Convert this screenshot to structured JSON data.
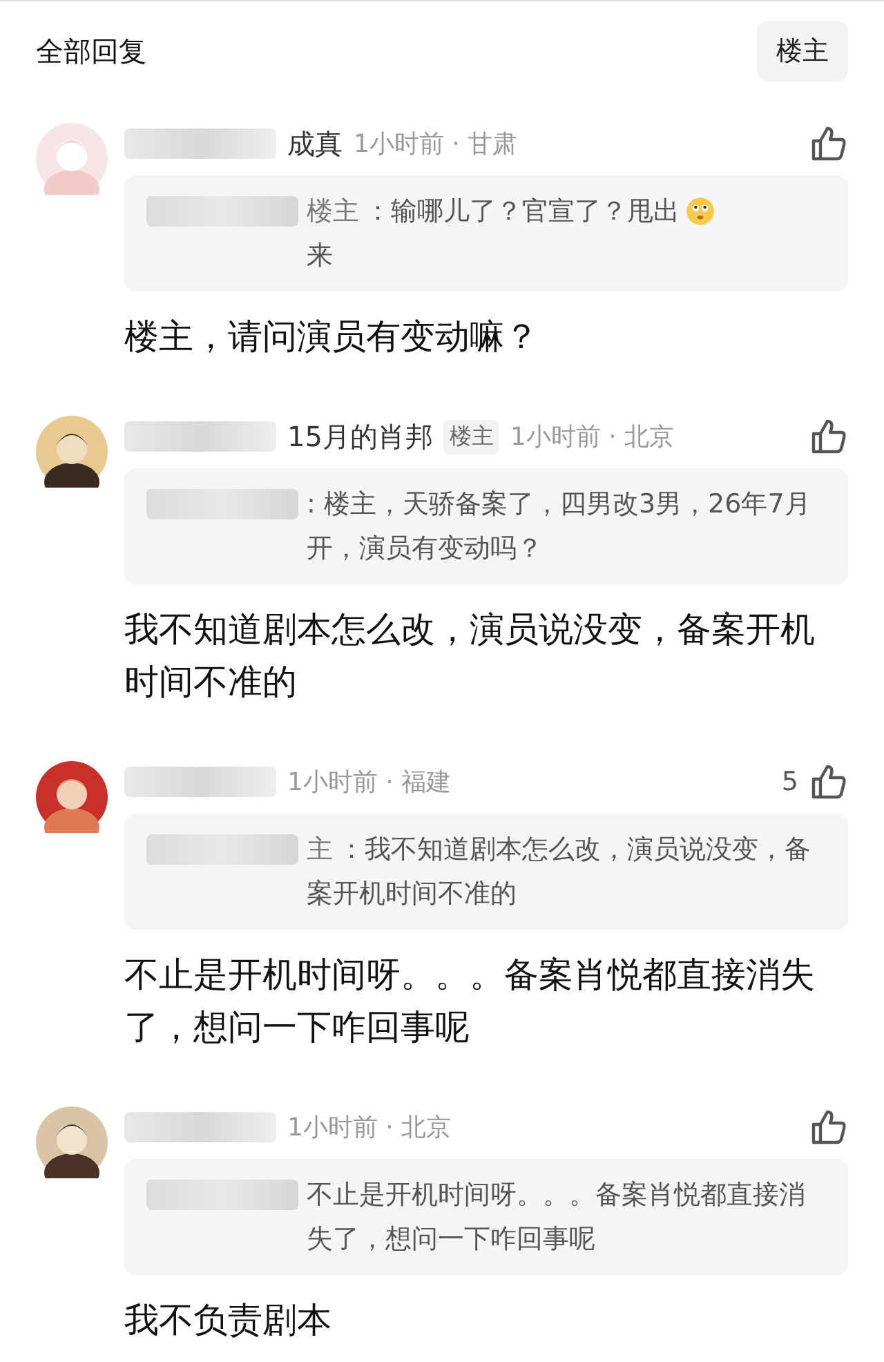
{
  "header": {
    "title": "全部回复",
    "filter_button": "楼主"
  },
  "comments": [
    {
      "name": "成真",
      "meta": "1小时前 · 甘肃",
      "quote": {
        "tag": "楼主",
        "text": "：输哪儿了？官宣了？甩出来",
        "emoji": true
      },
      "text": "楼主，请问演员有变动嘛？"
    },
    {
      "name": "15月的肖邦",
      "badge": "楼主",
      "meta": "1小时前 · 北京",
      "quote": {
        "text": ": 楼主，天骄备案了，四男改3男，26年7月开，演员有变动吗？"
      },
      "text": "我不知道剧本怎么改，演员说没变，备案开机时间不准的"
    },
    {
      "meta": "1小时前 · 福建",
      "likes": "5",
      "quote": {
        "tag": "主",
        "text": "：我不知道剧本怎么改，演员说没变，备案开机时间不准的"
      },
      "text": "不止是开机时间呀。。。备案肖悦都直接消失了，想问一下咋回事呢"
    },
    {
      "meta": "1小时前 · 北京",
      "quote": {
        "text": "不止是开机时间呀。。。备案肖悦都直接消失了，想问一下咋回事呢"
      },
      "text": "我不负责剧本"
    }
  ]
}
